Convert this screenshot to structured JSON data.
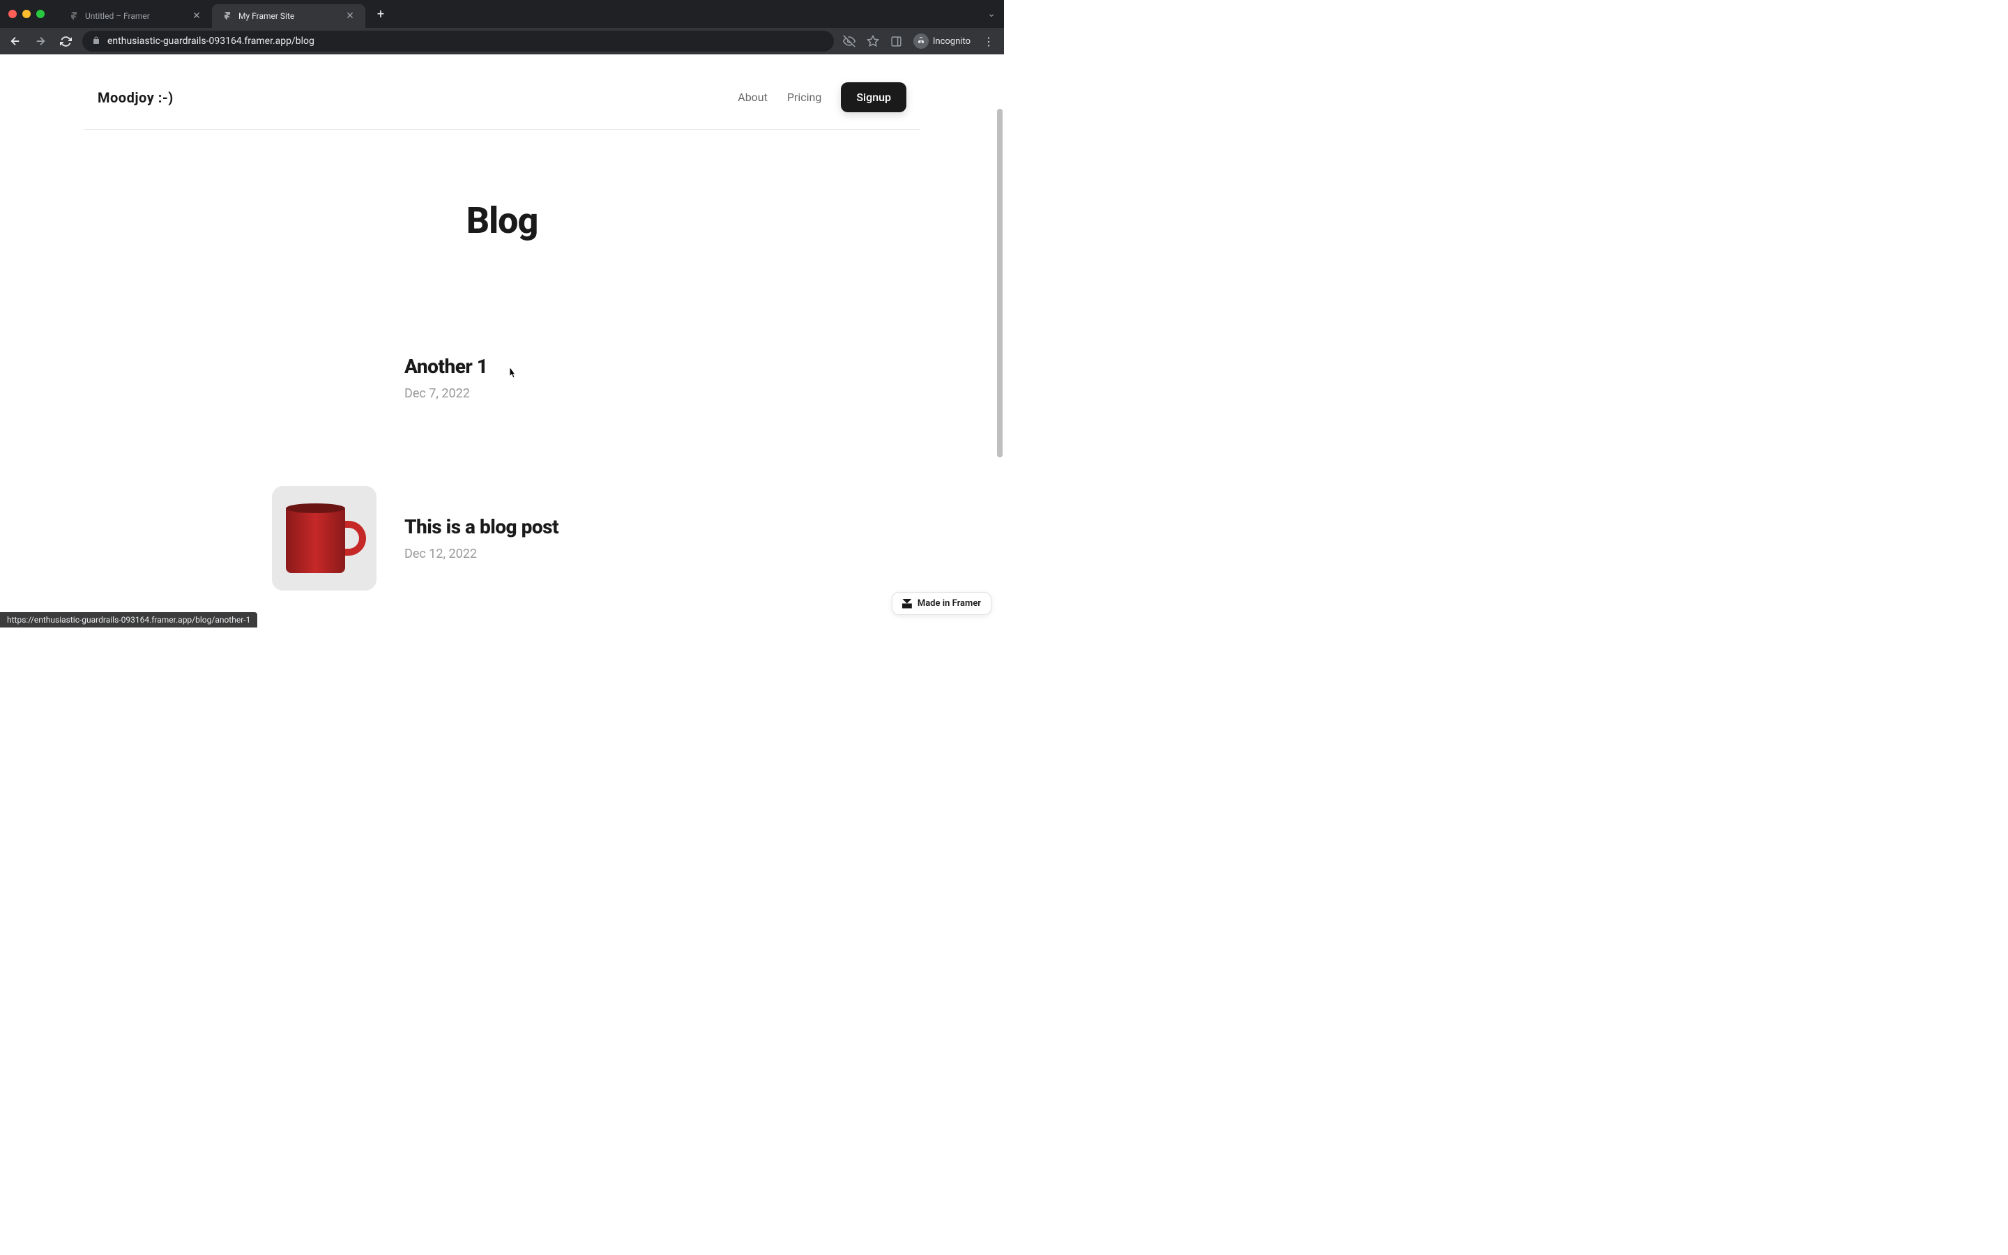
{
  "browser": {
    "tabs": [
      {
        "title": "Untitled – Framer",
        "active": false
      },
      {
        "title": "My Framer Site",
        "active": true
      }
    ],
    "url": "enthusiastic-guardrails-093164.framer.app/blog",
    "incognito_label": "Incognito"
  },
  "site": {
    "logo": "Moodjoy :-)",
    "nav": {
      "about": "About",
      "pricing": "Pricing",
      "signup": "Signup"
    },
    "page_title": "Blog",
    "posts": [
      {
        "title": "Another 1",
        "date": "Dec 7, 2022",
        "has_image": false
      },
      {
        "title": "This is a blog post",
        "date": "Dec 12, 2022",
        "has_image": true
      }
    ],
    "framer_badge": "Made in Framer"
  },
  "status_url": "https://enthusiastic-guardrails-093164.framer.app/blog/another-1"
}
